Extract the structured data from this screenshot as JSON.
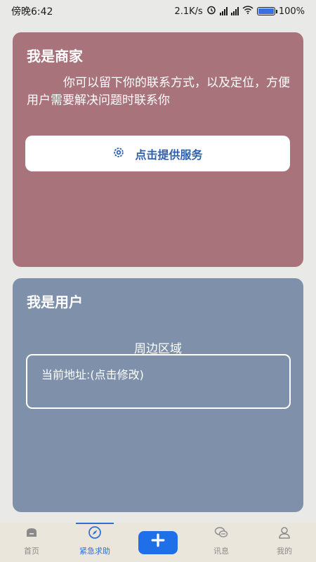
{
  "status_bar": {
    "time": "傍晚6:42",
    "network_speed": "2.1K/s",
    "battery": "100%"
  },
  "merchant_card": {
    "title": "我是商家",
    "description": "你可以留下你的联系方式，以及定位，方便用户需要解决问题时联系你",
    "provide_button_label": "点击提供服务",
    "background": "#a8737b"
  },
  "user_card": {
    "title": "我是用户",
    "area_title": "周边区域",
    "address_label": "当前地址:(点击修改)",
    "background": "#7e90aa"
  },
  "bottom_nav": {
    "items": [
      {
        "label": "首页",
        "icon": "home-icon",
        "active": false
      },
      {
        "label": "紧急求助",
        "icon": "compass-icon",
        "active": true
      },
      {
        "label": "",
        "icon": "plus-icon",
        "active": false
      },
      {
        "label": "讯息",
        "icon": "chat-icon",
        "active": false
      },
      {
        "label": "我的",
        "icon": "user-icon",
        "active": false
      }
    ],
    "accent": "#2f6fd1",
    "add_button_color": "#1e6fe8"
  }
}
